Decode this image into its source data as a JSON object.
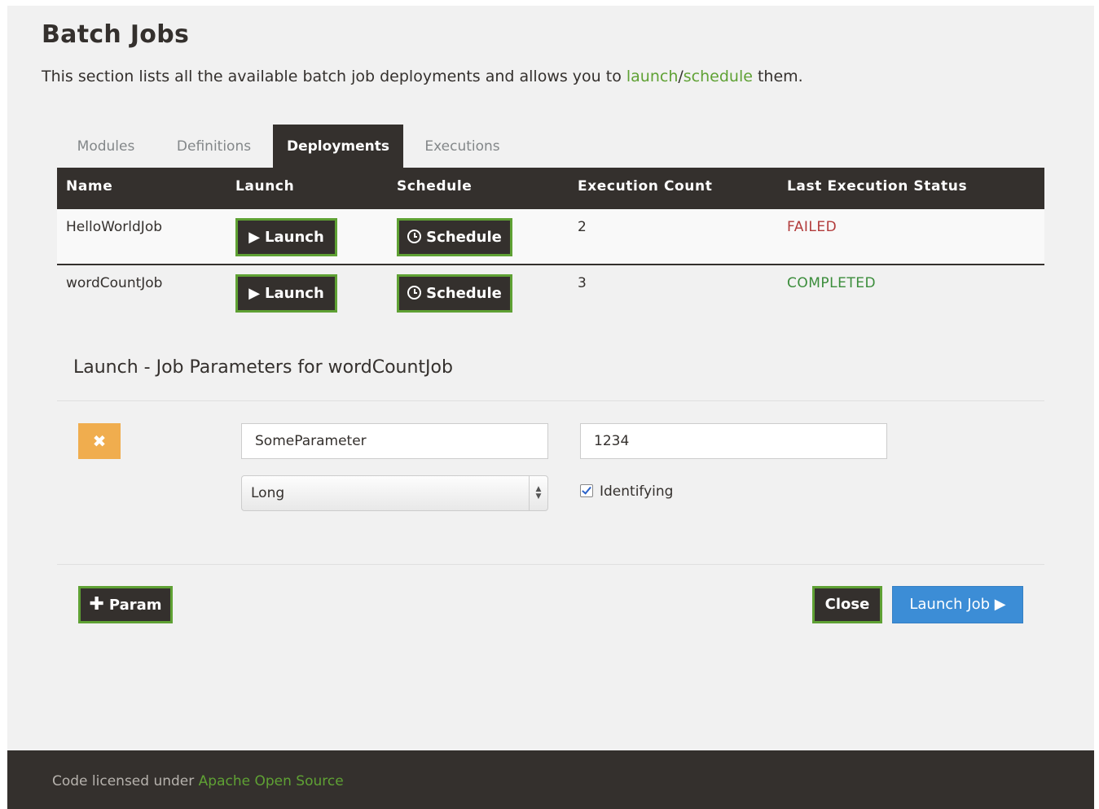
{
  "page": {
    "title": "Batch Jobs",
    "description_prefix": "This section lists all the available batch job deployments and allows you to ",
    "description_link1": "launch",
    "description_sep": "/",
    "description_link2": "schedule",
    "description_suffix": " them."
  },
  "tabs": [
    {
      "label": "Modules",
      "active": false
    },
    {
      "label": "Definitions",
      "active": false
    },
    {
      "label": "Deployments",
      "active": true
    },
    {
      "label": "Executions",
      "active": false
    }
  ],
  "table": {
    "headers": [
      "Name",
      "Launch",
      "Schedule",
      "Execution Count",
      "Last Execution Status"
    ],
    "rows": [
      {
        "name": "HelloWorldJob",
        "launch_label": "Launch",
        "schedule_label": "Schedule",
        "count": "2",
        "status": "FAILED"
      },
      {
        "name": "wordCountJob",
        "launch_label": "Launch",
        "schedule_label": "Schedule",
        "count": "3",
        "status": "COMPLETED"
      }
    ]
  },
  "launch_form": {
    "title": "Launch - Job Parameters for wordCountJob",
    "remove_icon": "close-icon",
    "param_name": "SomeParameter",
    "param_value": "1234",
    "type_selected": "Long",
    "identifying_label": "Identifying",
    "identifying_checked": true,
    "add_param_label": "Param",
    "close_label": "Close",
    "launch_job_label": "Launch Job"
  },
  "footer": {
    "text": "Code licensed under ",
    "link": "Apache Open Source"
  },
  "colors": {
    "brand_dark": "#34302d",
    "accent_green": "#5fa134",
    "failed": "#b23c3c",
    "completed": "#3b8d3b",
    "warning": "#f0ad4e",
    "primary_blue": "#3c8dd6"
  }
}
